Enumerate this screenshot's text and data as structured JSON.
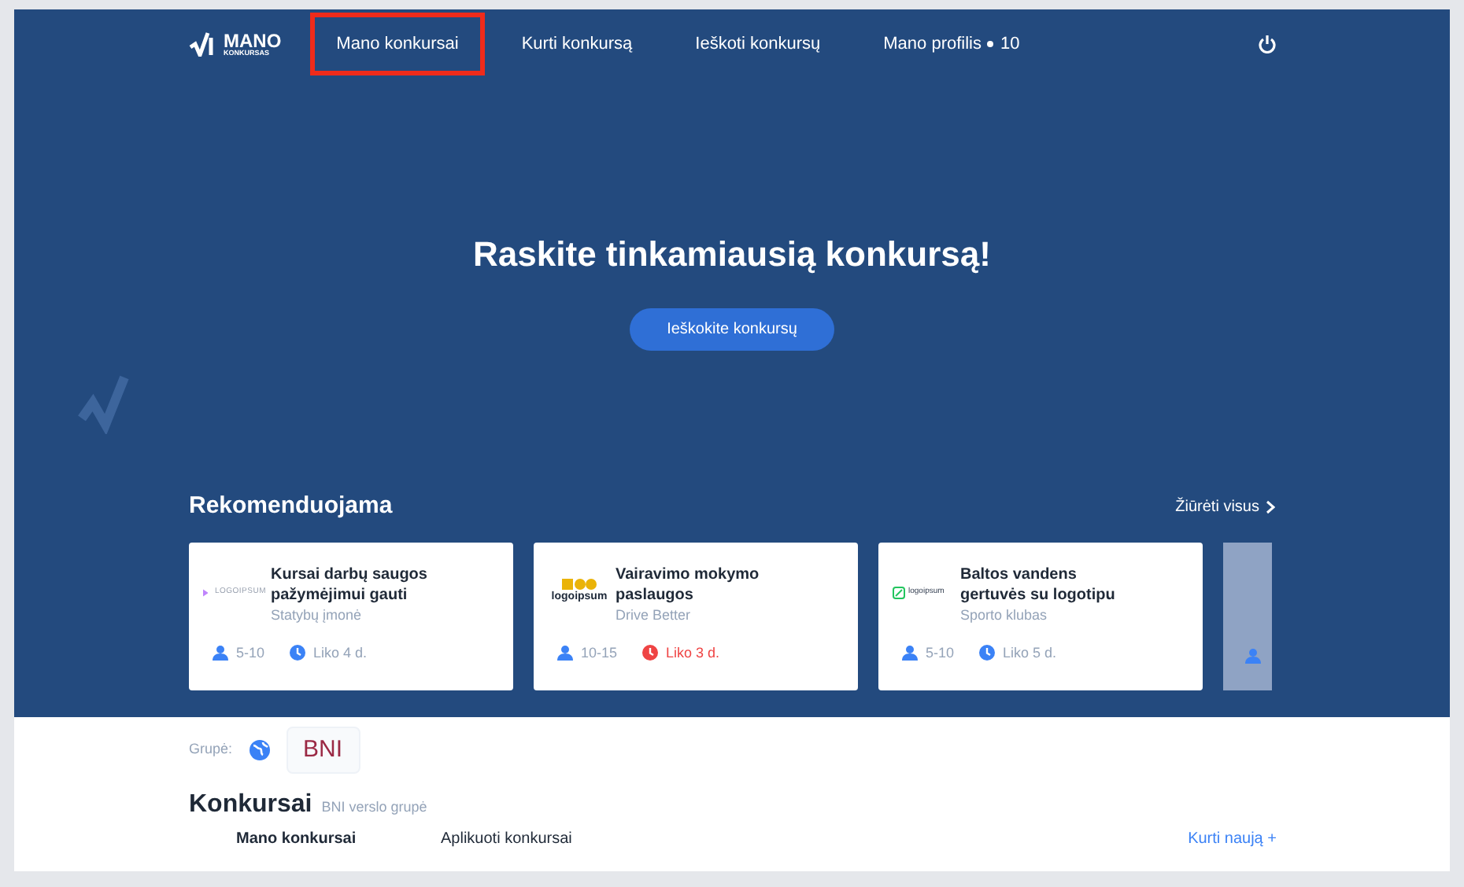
{
  "logo": {
    "title": "MANO",
    "subtitle": "KONKURSAS"
  },
  "nav": [
    {
      "label": "Mano konkursai",
      "selected": true
    },
    {
      "label": "Kurti konkursą",
      "selected": false
    },
    {
      "label": "Ieškoti konkursų",
      "selected": false
    },
    {
      "label": "Mano profilis",
      "selected": false,
      "count": "10"
    }
  ],
  "hero": {
    "title": "Raskite tinkamiausią konkursą!",
    "button": "Ieškokite konkursų"
  },
  "recommended": {
    "title": "Rekomenduojama",
    "see_all": "Žiūrėti visus",
    "cards": [
      {
        "kind": "triangle",
        "logo_text": "LOGOIPSUM",
        "title": "Kursai darbų saugos pažymėjimui gauti",
        "company": "Statybų įmonė",
        "people": "5-10",
        "deadline": "Liko 4 d.",
        "urgent": false
      },
      {
        "kind": "dots",
        "logo_text": "logoipsum",
        "title": "Vairavimo mokymo paslaugos",
        "company": "Drive Better",
        "people": "10-15",
        "deadline": "Liko 3 d.",
        "urgent": true
      },
      {
        "kind": "leaf",
        "logo_text": "logoipsum",
        "title": "Baltos vandens gertuvės su logotipu",
        "company": "Sporto klubas",
        "people": "5-10",
        "deadline": "Liko 5 d.",
        "urgent": false
      }
    ]
  },
  "group": {
    "label": "Grupė:",
    "badge": "BNI"
  },
  "contests": {
    "title": "Konkursai",
    "subtitle": "BNI verslo grupė",
    "tabs": [
      {
        "label": "Mano konkursai",
        "selected": true
      },
      {
        "label": "Aplikuoti konkursai",
        "selected": false
      }
    ],
    "create": "Kurti naują +"
  }
}
